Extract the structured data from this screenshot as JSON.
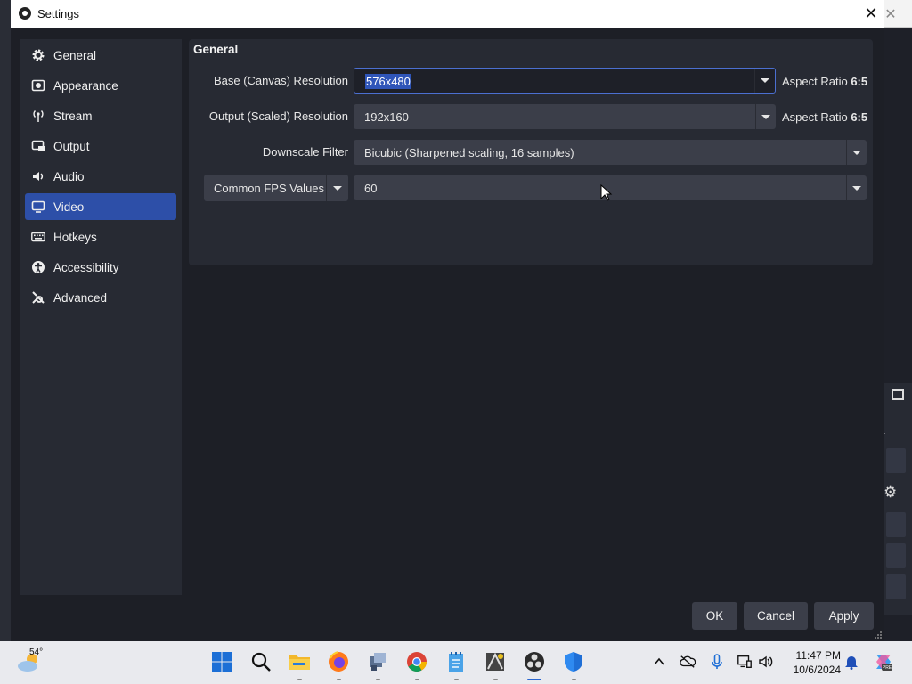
{
  "window": {
    "title": "Settings",
    "close_glyph": "✕"
  },
  "sidebar": {
    "items": [
      {
        "label": "General",
        "icon": "gear-icon",
        "active": false
      },
      {
        "label": "Appearance",
        "icon": "appearance-icon",
        "active": false
      },
      {
        "label": "Stream",
        "icon": "stream-icon",
        "active": false
      },
      {
        "label": "Output",
        "icon": "output-icon",
        "active": false
      },
      {
        "label": "Audio",
        "icon": "speaker-icon",
        "active": false
      },
      {
        "label": "Video",
        "icon": "monitor-icon",
        "active": true
      },
      {
        "label": "Hotkeys",
        "icon": "keyboard-icon",
        "active": false
      },
      {
        "label": "Accessibility",
        "icon": "accessibility-icon",
        "active": false
      },
      {
        "label": "Advanced",
        "icon": "wrench-icon",
        "active": false
      }
    ]
  },
  "video": {
    "section_title": "General",
    "base_resolution": {
      "label": "Base (Canvas) Resolution",
      "value": "576x480",
      "aspect_label": "Aspect Ratio",
      "aspect_value": "6:5"
    },
    "output_resolution": {
      "label": "Output (Scaled) Resolution",
      "value": "192x160",
      "aspect_label": "Aspect Ratio",
      "aspect_value": "6:5"
    },
    "downscale_filter": {
      "label": "Downscale Filter",
      "value": "Bicubic (Sharpened scaling, 16 samples)"
    },
    "fps": {
      "type_label": "Common FPS Values",
      "value": "60"
    }
  },
  "buttons": {
    "ok": "OK",
    "cancel": "Cancel",
    "apply": "Apply"
  },
  "taskbar": {
    "weather_temp": "54°",
    "time": "11:47 PM",
    "date": "10/6/2024",
    "apps": [
      "start-icon",
      "search-icon",
      "file-explorer-icon",
      "firefox-icon",
      "network-app-icon",
      "chrome-icon",
      "notepad-icon",
      "app-icon",
      "obs-icon",
      "defender-icon"
    ]
  },
  "colors": {
    "accent": "#2d4fa8",
    "dialog_bg": "#1d1f26",
    "panel_bg": "#272a33",
    "control_bg": "#3b3e49"
  }
}
